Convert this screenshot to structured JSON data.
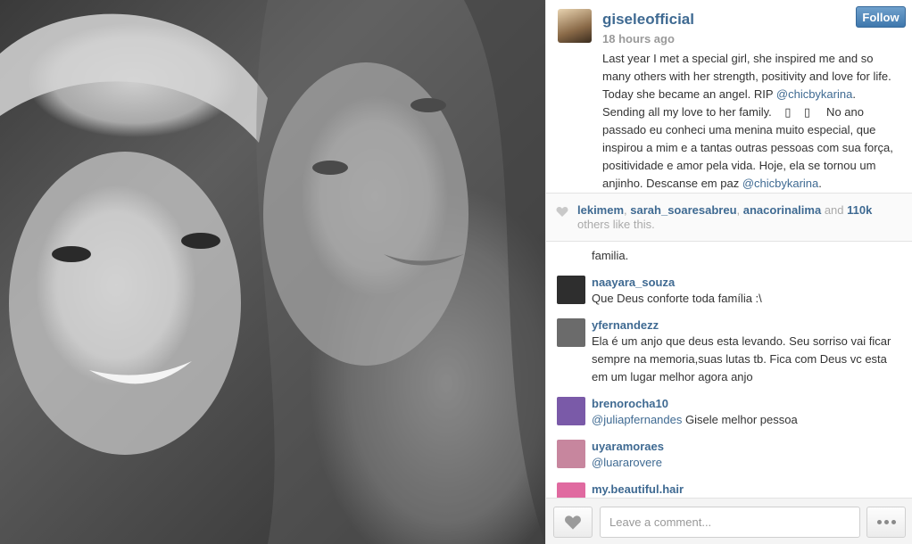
{
  "post": {
    "author": "giseleofficial",
    "time": "18 hours ago",
    "follow_label": "Follow",
    "caption_parts": {
      "p1": "Last year I met a special girl, she inspired me and so many others with her strength, positivity and love for life. Today she became an angel. RIP ",
      "mention1": "@chicbykarina",
      "p2": ". Sending all my love to her family.    ▯    ▯     No ano passado eu conheci uma menina muito especial, que inspirou a mim e a tantas outras pessoas com sua força, positividade e amor pela vida. Hoje, ela se tornou um anjinho. Descanse em paz ",
      "mention2": "@chicbykarina",
      "p3": "."
    }
  },
  "likes": {
    "users": [
      "lekimem",
      "sarah_soaresabreu",
      "anacorinalima"
    ],
    "sep": ", ",
    "and_text": " and ",
    "count": "110k",
    "suffix": " others like this."
  },
  "comments": {
    "partial_text": "familia.",
    "items": [
      {
        "user": "naayara_souza",
        "text": "Que Deus conforte toda família :\\",
        "avatar_color": "#2e2e2e"
      },
      {
        "user": "yfernandezz",
        "text": "Ela é um anjo que deus esta levando. Seu sorriso vai ficar sempre na memoria,suas lutas tb. Fica com Deus vc esta em um lugar melhor agora anjo",
        "avatar_color": "#6b6b6b"
      },
      {
        "user": "brenorocha10",
        "mention": "@juliapfernandes",
        "text": " Gisele melhor pessoa",
        "avatar_color": "#7a5aa8"
      },
      {
        "user": "uyaramoraes",
        "mention": "@luararovere",
        "text": "",
        "avatar_color": "#c7869e"
      },
      {
        "user": "my.beautiful.hair",
        "text": "",
        "avatar_color": "#e06aa0"
      }
    ]
  },
  "footer": {
    "comment_placeholder": "Leave a comment..."
  },
  "icons": {
    "heart": "heart-icon",
    "more": "more-dots-icon"
  }
}
